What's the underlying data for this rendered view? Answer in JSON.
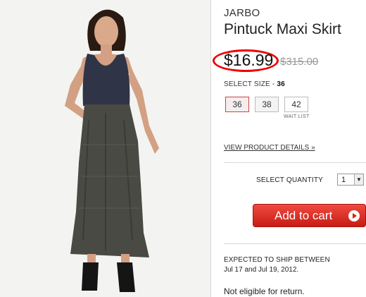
{
  "product": {
    "brand": "JARBO",
    "title": "Pintuck Maxi Skirt",
    "price": "$16.99",
    "original_price": "$315.00"
  },
  "size": {
    "label": "SELECT SIZE - ",
    "selected": "36",
    "options": [
      "36",
      "38",
      "42"
    ],
    "waitlist_note": "WAIT LIST"
  },
  "details_link": "VIEW PRODUCT DETAILS »",
  "quantity": {
    "label": "SELECT QUANTITY",
    "value": "1"
  },
  "cart_button": {
    "label": "Add to cart"
  },
  "shipping": {
    "heading": "EXPECTED TO SHIP BETWEEN",
    "dates": "Jul 17 and Jul 19, 2012."
  },
  "return_policy": "Not eligible for return.",
  "colors": {
    "accent_red": "#d42218",
    "highlight_ring": "#e00000"
  }
}
